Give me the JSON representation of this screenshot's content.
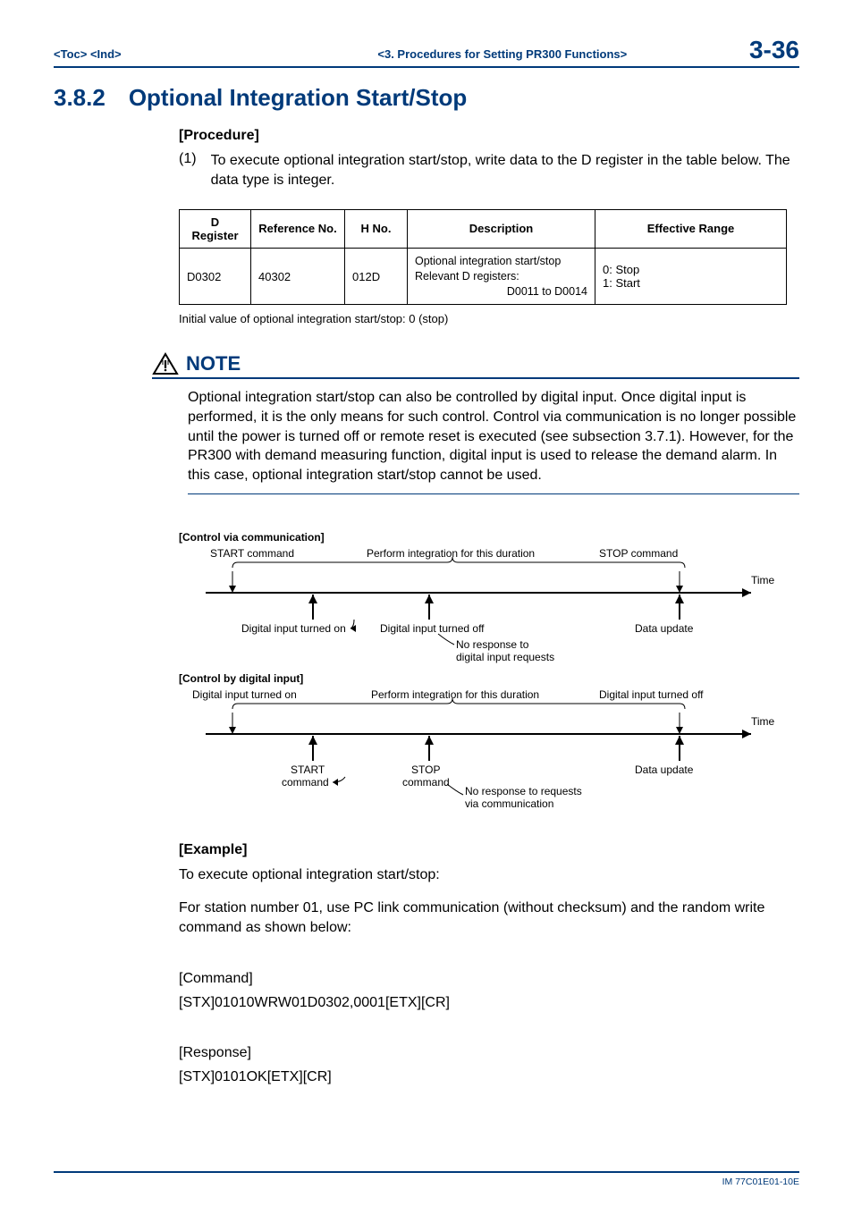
{
  "header": {
    "toc_link": "<Toc>",
    "ind_link": "<Ind>",
    "breadcrumb": "<3.  Procedures for Setting PR300 Functions>",
    "page_number": "3-36"
  },
  "section": {
    "number": "3.8.2",
    "title": "Optional Integration Start/Stop"
  },
  "procedure": {
    "label": "[Procedure]",
    "step_num": "(1)",
    "step_text": "To execute optional integration start/stop, write data to the D register in the table below. The data type is integer."
  },
  "table": {
    "headers": {
      "dreg": "D Register",
      "refno": "Reference No.",
      "hno": "H No.",
      "desc": "Description",
      "range": "Effective Range"
    },
    "row": {
      "dreg": "D0302",
      "refno": "40302",
      "hno": "012D",
      "desc_l1": "Optional integration start/stop",
      "desc_l2": "Relevant D registers:",
      "desc_l3": "D0011 to D0014",
      "range_l1": "0: Stop",
      "range_l2": "1: Start"
    }
  },
  "caption": "Initial value of optional integration start/stop: 0 (stop)",
  "note": {
    "title": "NOTE",
    "body": "Optional integration start/stop can also be controlled by digital input. Once digital input is performed, it is the only means for such control. Control via communication is no longer possible until the power is turned off or remote reset is executed (see subsection 3.7.1). However, for the PR300 with demand measuring function, digital input is used to release the demand alarm.  In this case, optional integration start/stop cannot be used."
  },
  "diagram": {
    "comm_header": "[Control via communication]",
    "start_cmd": "START command",
    "perform_duration": "Perform integration for this duration",
    "stop_cmd": "STOP command",
    "time": "Time",
    "di_on": "Digital input turned on",
    "di_off": "Digital input turned off",
    "data_update": "Data update",
    "no_response_di": "No response to",
    "no_response_di2": "digital input requests",
    "di_header": "[Control by digital input]",
    "start_word": "START",
    "stop_word": "STOP",
    "command_word": "command",
    "no_response_comm": "No response to requests",
    "no_response_comm2": "via communication"
  },
  "example": {
    "label": "[Example]",
    "intro": "To execute optional integration start/stop:",
    "body": "For station number 01, use PC link communication (without checksum) and the random write command as shown below:",
    "command_label": "[Command]",
    "command_value": "[STX]01010WRW01D0302,0001[ETX][CR]",
    "response_label": "[Response]",
    "response_value": "[STX]0101OK[ETX][CR]"
  },
  "footer": "IM 77C01E01-10E"
}
